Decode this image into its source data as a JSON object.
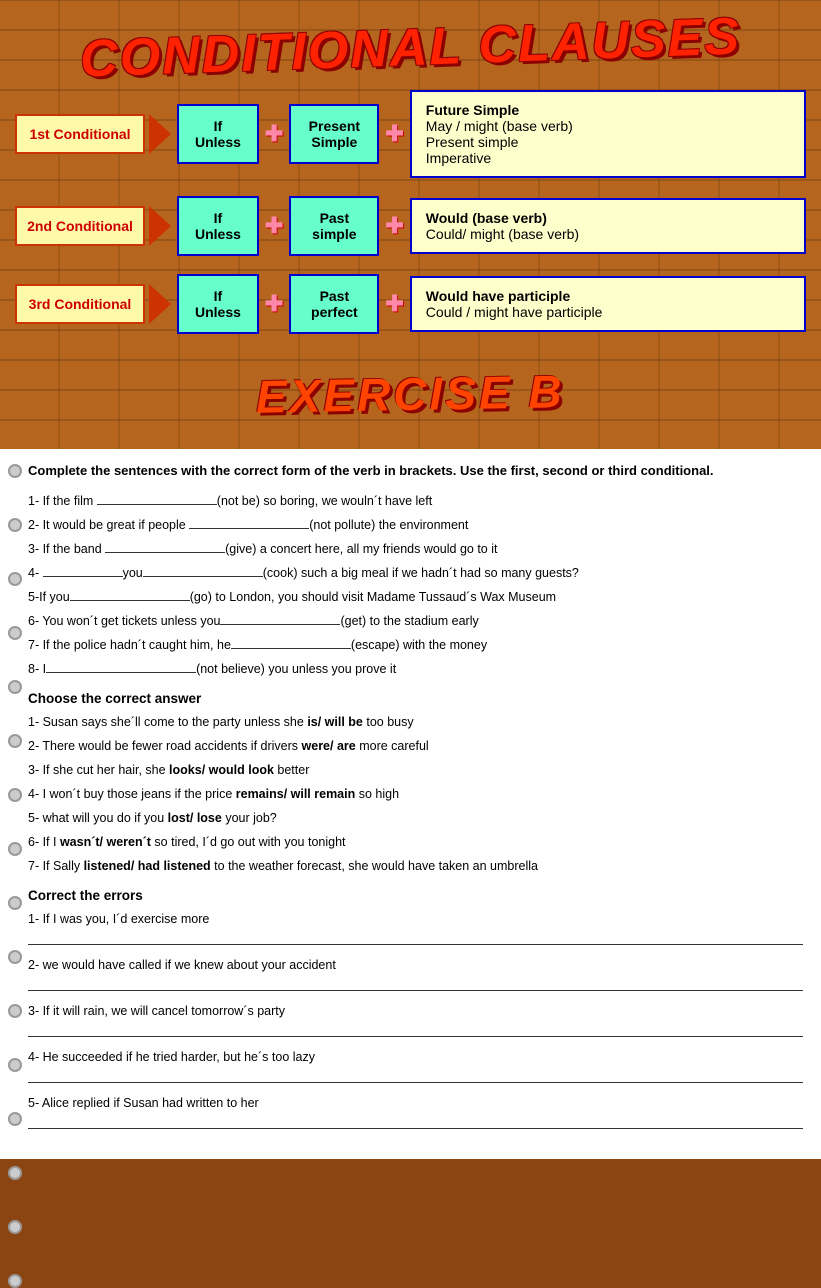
{
  "title": "CONDITIONAL CLAUSES",
  "exercise_title": "EXERCISE B",
  "conditionals": [
    {
      "label": "1st  Conditional",
      "if_text": "If\nUnless",
      "verb_text": "Present\nSimple",
      "result_lines": [
        "Future  Simple",
        "May / might (base verb)",
        "Present simple",
        "Imperative"
      ]
    },
    {
      "label": "2nd Conditional",
      "if_text": "If\nUnless",
      "verb_text": "Past\nsimple",
      "result_lines": [
        "Would (base verb)",
        "Could/ might (base verb)"
      ]
    },
    {
      "label": "3rd Conditional",
      "if_text": "If\nUnless",
      "verb_text": "Past\nperfect",
      "result_lines": [
        "Would have participle",
        "Could / might have participle"
      ]
    }
  ],
  "section1_header": "Complete the sentences with the correct form of the verb in brackets. Use the first, second or third conditional.",
  "sentences1": [
    "1- If the film ________________(not be) so boring, we wouln´t have left",
    "2- It would be great if people __________________(not pollute) the environment",
    "3- If the band _______________(give) a concert here, all my friends would go to it",
    "4- ______________you________________(cook) such a big meal if we hadn´t had so many guests?",
    "5-If you________________(go) to London, you should visit Madame Tussaud´s Wax Museum",
    "6- You won´t get tickets unless you__________________(get) to the stadium early",
    "7- If the police hadn´t caught him, he__________________(escape) with the money",
    "8- I_______________________(not believe) you unless you prove it"
  ],
  "section2_header": "Choose the correct answer",
  "sentences2": [
    {
      "text": "1- Susan says she´ll come to the party unless she ",
      "bold": "is/ will be",
      "rest": " too busy"
    },
    {
      "text": "2- There would be fewer road accidents if drivers ",
      "bold": "were/ are",
      "rest": " more careful"
    },
    {
      "text": "3- If she cut her hair, she ",
      "bold": "looks/ would look",
      "rest": " better"
    },
    {
      "text": "4- I won´t buy those jeans if the price ",
      "bold": "remains/ will remain",
      "rest": " so high"
    },
    {
      "text": "5- what will you do if you ",
      "bold": "lost/ lose",
      "rest": " your job?"
    },
    {
      "text": "6- If I ",
      "bold": "wasn´t/ weren´t",
      "rest": " so tired, I´d go out with you tonight"
    },
    {
      "text": "7- If Sally ",
      "bold": "listened/ had listened",
      "rest": " to the weather forecast, she would have taken an umbrella"
    }
  ],
  "section3_header": "Correct the errors",
  "sentences3": [
    "1- If I was you, I´d exercise more",
    "2- we would have called if we knew about your accident",
    "3- If it will rain, we will cancel tomorrow´s party",
    "4- He succeeded if he tried harder, but he´s too lazy",
    "5- Alice replied if Susan had written to her"
  ]
}
